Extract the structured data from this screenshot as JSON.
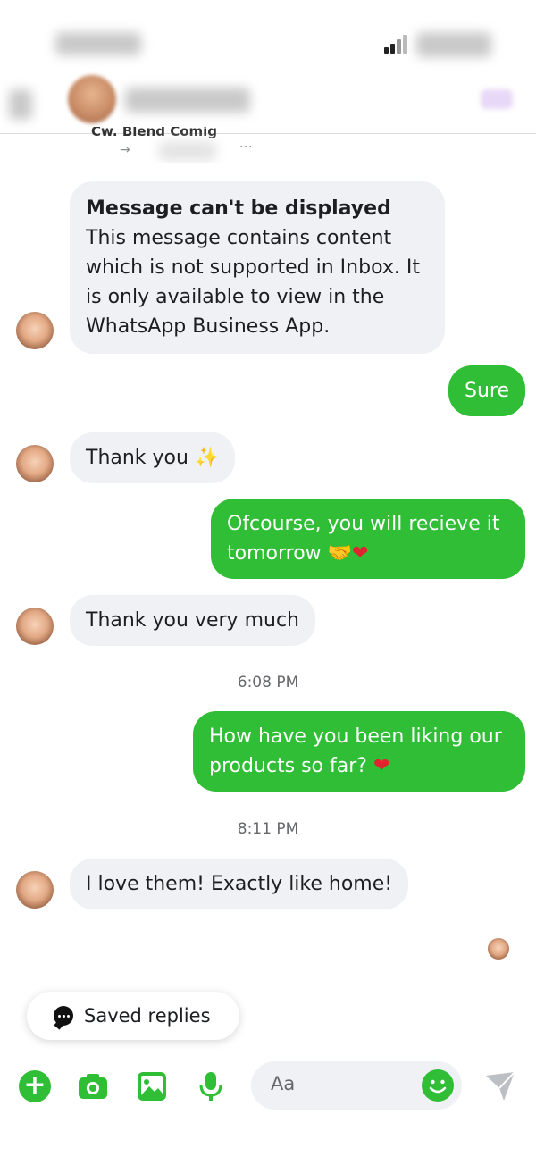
{
  "colors": {
    "accent_green": "#2fbe35",
    "incoming_bubble": "#eff1f5",
    "meta_text": "#65676b"
  },
  "preview": {
    "title": "Cw. Blend Comig",
    "arrow": "→",
    "more": "···"
  },
  "messages": [
    {
      "direction": "in",
      "title": "Message can't be displayed",
      "text": "This message contains content which is not supported in Inbox. It is only available to view in the WhatsApp Business App."
    },
    {
      "direction": "out",
      "text": "Sure"
    },
    {
      "direction": "in",
      "text": "Thank you",
      "emoji": "✨"
    },
    {
      "direction": "out",
      "text": "Ofcourse, you will recieve it tomorrow",
      "emoji": "🤝❤"
    },
    {
      "direction": "in",
      "text": "Thank you very much"
    },
    {
      "direction": "out",
      "text": "How have you been liking our products so far?",
      "emoji": "❤"
    },
    {
      "direction": "in",
      "text": "I love them! Exactly like home!"
    }
  ],
  "timestamps": [
    "6:08 PM",
    "8:11 PM"
  ],
  "saved_replies": {
    "label": "Saved replies",
    "icon": "chat-bubble-icon"
  },
  "composer": {
    "placeholder": "Aa",
    "icons": [
      "plus-icon",
      "camera-icon",
      "image-icon",
      "microphone-icon",
      "emoji-icon",
      "send-icon"
    ]
  }
}
